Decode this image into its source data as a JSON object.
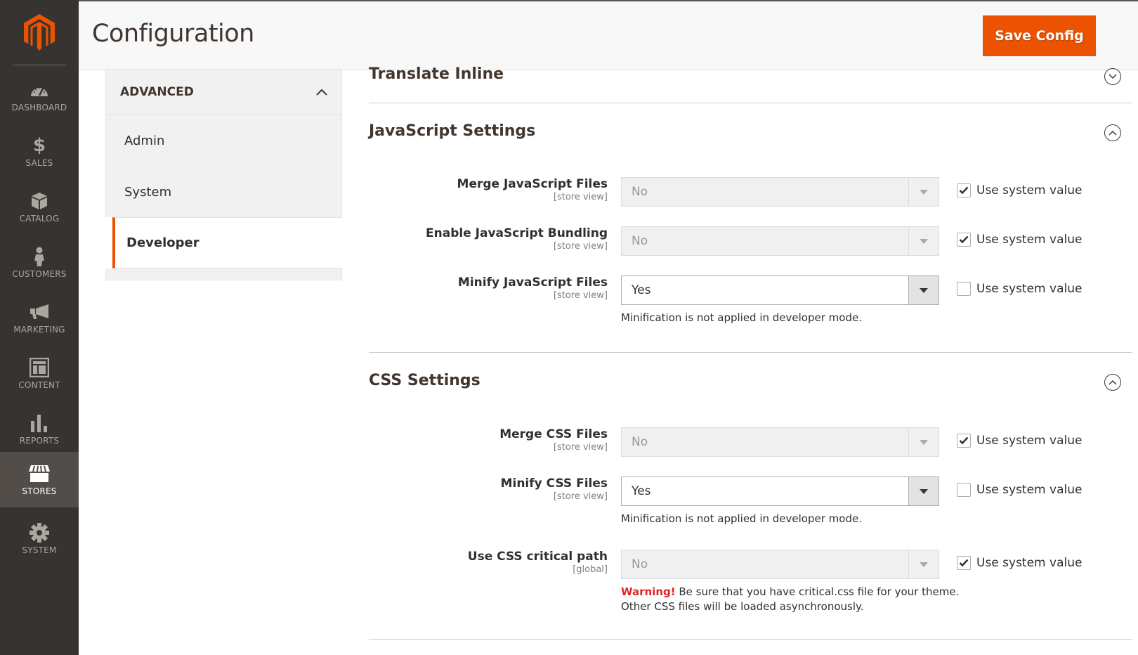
{
  "header": {
    "title": "Configuration",
    "save_label": "Save Config"
  },
  "admin_nav": {
    "items": [
      {
        "label": "Dashboard",
        "icon": "dashboard-icon"
      },
      {
        "label": "Sales",
        "icon": "dollar-icon"
      },
      {
        "label": "Catalog",
        "icon": "box-icon"
      },
      {
        "label": "Customers",
        "icon": "person-icon"
      },
      {
        "label": "Marketing",
        "icon": "megaphone-icon"
      },
      {
        "label": "Content",
        "icon": "layout-icon"
      },
      {
        "label": "Reports",
        "icon": "bar-chart-icon"
      },
      {
        "label": "Stores",
        "icon": "storefront-icon",
        "active": true
      },
      {
        "label": "System",
        "icon": "gear-icon"
      }
    ]
  },
  "config_tabs": {
    "group_title": "ADVANCED",
    "items": [
      {
        "label": "Admin"
      },
      {
        "label": "System"
      },
      {
        "label": "Developer",
        "active": true
      }
    ]
  },
  "sections": {
    "translate_inline": {
      "title": "Translate Inline",
      "expanded": false
    },
    "javascript": {
      "title": "JavaScript Settings",
      "expanded": true,
      "rows": [
        {
          "label": "Merge JavaScript Files",
          "scope": "[store view]",
          "value": "No",
          "disabled": true,
          "use_system": true
        },
        {
          "label": "Enable JavaScript Bundling",
          "scope": "[store view]",
          "value": "No",
          "disabled": true,
          "use_system": true
        },
        {
          "label": "Minify JavaScript Files",
          "scope": "[store view]",
          "value": "Yes",
          "disabled": false,
          "use_system": false,
          "note": "Minification is not applied in developer mode."
        }
      ]
    },
    "css": {
      "title": "CSS Settings",
      "expanded": true,
      "rows": [
        {
          "label": "Merge CSS Files",
          "scope": "[store view]",
          "value": "No",
          "disabled": true,
          "use_system": true
        },
        {
          "label": "Minify CSS Files",
          "scope": "[store view]",
          "value": "Yes",
          "disabled": false,
          "use_system": false,
          "note": "Minification is not applied in developer mode."
        },
        {
          "label": "Use CSS critical path",
          "scope": "[global]",
          "value": "No",
          "disabled": true,
          "use_system": true,
          "warning_label": "Warning!",
          "note_line1": " Be sure that you have critical.css file for your theme.",
          "note_line2": "Other CSS files will be loaded asynchronously."
        }
      ]
    }
  },
  "use_system_label": "Use system value",
  "colors": {
    "accent": "#eb5202",
    "sidebar_bg": "#373330",
    "sidebar_active": "#524d49",
    "warning": "#e22626"
  }
}
